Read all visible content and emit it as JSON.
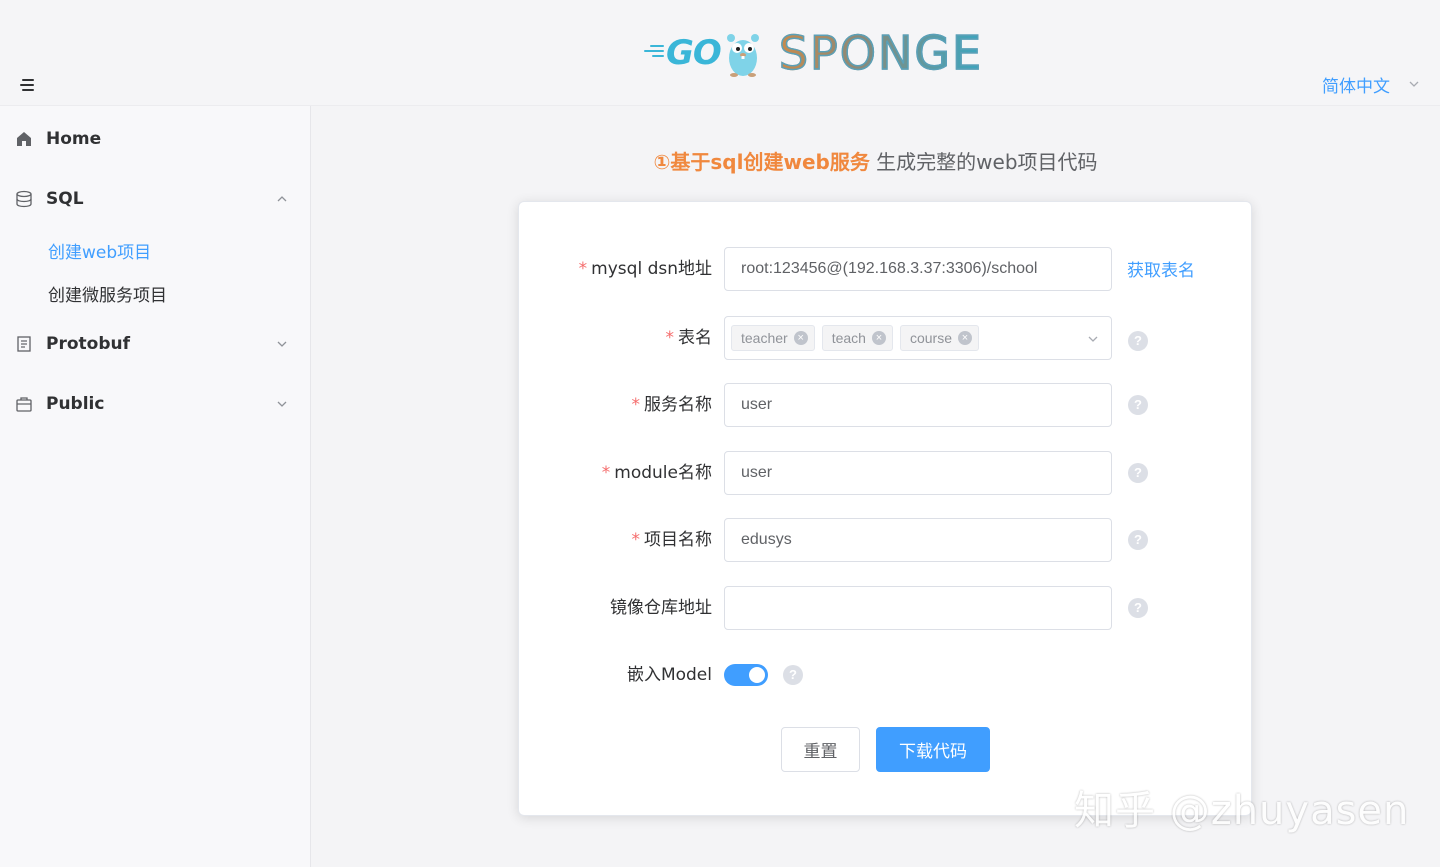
{
  "header": {
    "logo_text": "SPONGE",
    "logo_go": "GO",
    "language": "简体中文"
  },
  "sidebar": {
    "items": [
      {
        "label": "Home",
        "icon": "home-icon"
      },
      {
        "label": "SQL",
        "icon": "database-icon",
        "expanded": true,
        "children": [
          {
            "label": "创建web项目",
            "active": true
          },
          {
            "label": "创建微服务项目",
            "active": false
          }
        ]
      },
      {
        "label": "Protobuf",
        "icon": "document-icon",
        "expanded": false
      },
      {
        "label": "Public",
        "icon": "briefcase-icon",
        "expanded": false
      }
    ]
  },
  "main": {
    "title_accent": "①基于sql创建web服务",
    "title_rest": " 生成完整的web项目代码"
  },
  "form": {
    "dsn": {
      "label": "mysql dsn地址",
      "value": "root:123456@(192.168.3.37:3306)/school",
      "action": "获取表名"
    },
    "tables": {
      "label": "表名",
      "tags": [
        "teacher",
        "teach",
        "course"
      ]
    },
    "service_name": {
      "label": "服务名称",
      "value": "user"
    },
    "module_name": {
      "label": "module名称",
      "value": "user"
    },
    "project_name": {
      "label": "项目名称",
      "value": "edusys"
    },
    "repo_addr": {
      "label": "镜像仓库地址",
      "value": ""
    },
    "embed_model": {
      "label": "嵌入Model",
      "enabled": true
    },
    "help_glyph": "?",
    "required_mark": "*",
    "reset_label": "重置",
    "download_label": "下载代码"
  },
  "watermark": "知乎 @zhuyasen",
  "colors": {
    "primary": "#409eff",
    "accent": "#f0883e",
    "required": "#f56c6c"
  }
}
